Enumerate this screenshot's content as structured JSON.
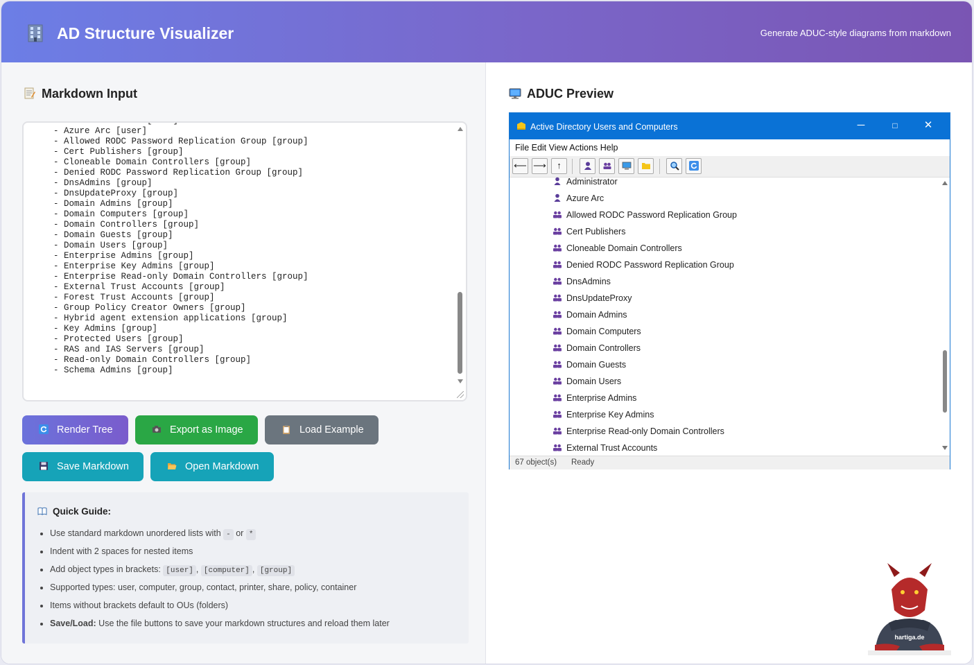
{
  "header": {
    "title": "AD Structure Visualizer",
    "tagline": "Generate ADUC-style diagrams from markdown",
    "logo_icon": "building-icon"
  },
  "left": {
    "title": "Markdown Input",
    "title_icon": "memo-icon",
    "markdown": "  - Administrator [user]\n- Azure Arc [user]\n- Allowed RODC Password Replication Group [group]\n- Cert Publishers [group]\n- Cloneable Domain Controllers [group]\n- Denied RODC Password Replication Group [group]\n- DnsAdmins [group]\n- DnsUpdateProxy [group]\n- Domain Admins [group]\n- Domain Computers [group]\n- Domain Controllers [group]\n- Domain Guests [group]\n- Domain Users [group]\n- Enterprise Admins [group]\n- Enterprise Key Admins [group]\n- Enterprise Read-only Domain Controllers [group]\n- External Trust Accounts [group]\n- Forest Trust Accounts [group]\n- Group Policy Creator Owners [group]\n- Hybrid agent extension applications [group]\n- Key Admins [group]\n- Protected Users [group]\n- RAS and IAS Servers [group]\n- Read-only Domain Controllers [group]\n- Schema Admins [group]",
    "buttons": {
      "render": "Render Tree",
      "export": "Export as Image",
      "load": "Load Example",
      "save": "Save Markdown",
      "open": "Open Markdown"
    },
    "guide": {
      "title": "Quick Guide:",
      "title_icon": "book-icon",
      "item1_pre": "Use standard markdown unordered lists with",
      "item1_code_a": "-",
      "item1_mid": "or",
      "item1_code_b": "*",
      "item2": "Indent with 2 spaces for nested items",
      "item3_pre": "Add object types in brackets:",
      "item3_code_a": "[user]",
      "item3_code_b": "[computer]",
      "item3_code_c": "[group]",
      "item3_sep": ",",
      "item4": "Supported types: user, computer, group, contact, printer, share, policy, container",
      "item5": "Items without brackets default to OUs (folders)",
      "item6_bold": "Save/Load:",
      "item6_rest": "Use the file buttons to save your markdown structures and reload them later"
    }
  },
  "right": {
    "title": "ADUC Preview",
    "title_icon": "monitor-icon",
    "window": {
      "title": "Active Directory Users and Computers",
      "menu": "File Edit View Actions Help",
      "status_count": "67 object(s)",
      "status_state": "Ready",
      "controls": {
        "minimize": "─",
        "maximize": "□",
        "close": "✕"
      },
      "toolbar_icons": [
        "back-arrow-icon",
        "forward-arrow-icon",
        "up-arrow-icon",
        "new-user-icon",
        "new-group-icon",
        "new-computer-icon",
        "new-ou-icon",
        "find-icon",
        "refresh-icon"
      ],
      "tree": [
        {
          "name": "Administrator",
          "type": "user"
        },
        {
          "name": "Azure Arc",
          "type": "user"
        },
        {
          "name": "Allowed RODC Password Replication Group",
          "type": "group"
        },
        {
          "name": "Cert Publishers",
          "type": "group"
        },
        {
          "name": "Cloneable Domain Controllers",
          "type": "group"
        },
        {
          "name": "Denied RODC Password Replication Group",
          "type": "group"
        },
        {
          "name": "DnsAdmins",
          "type": "group"
        },
        {
          "name": "DnsUpdateProxy",
          "type": "group"
        },
        {
          "name": "Domain Admins",
          "type": "group"
        },
        {
          "name": "Domain Computers",
          "type": "group"
        },
        {
          "name": "Domain Controllers",
          "type": "group"
        },
        {
          "name": "Domain Guests",
          "type": "group"
        },
        {
          "name": "Domain Users",
          "type": "group"
        },
        {
          "name": "Enterprise Admins",
          "type": "group"
        },
        {
          "name": "Enterprise Key Admins",
          "type": "group"
        },
        {
          "name": "Enterprise Read-only Domain Controllers",
          "type": "group"
        },
        {
          "name": "External Trust Accounts",
          "type": "group"
        }
      ]
    },
    "mascot_label": "hartiga.de"
  },
  "colors": {
    "header_start": "#6c7ee6",
    "header_end": "#7a55b3",
    "render_button": "#7163d6",
    "export_button": "#2aa745",
    "load_button": "#6b757e",
    "save_button": "#16a3b8",
    "open_button": "#16a3b8",
    "window_titlebar": "#0a72d6",
    "user_icon": "#5a3d9a",
    "group_icon": "#6a3fa0"
  }
}
